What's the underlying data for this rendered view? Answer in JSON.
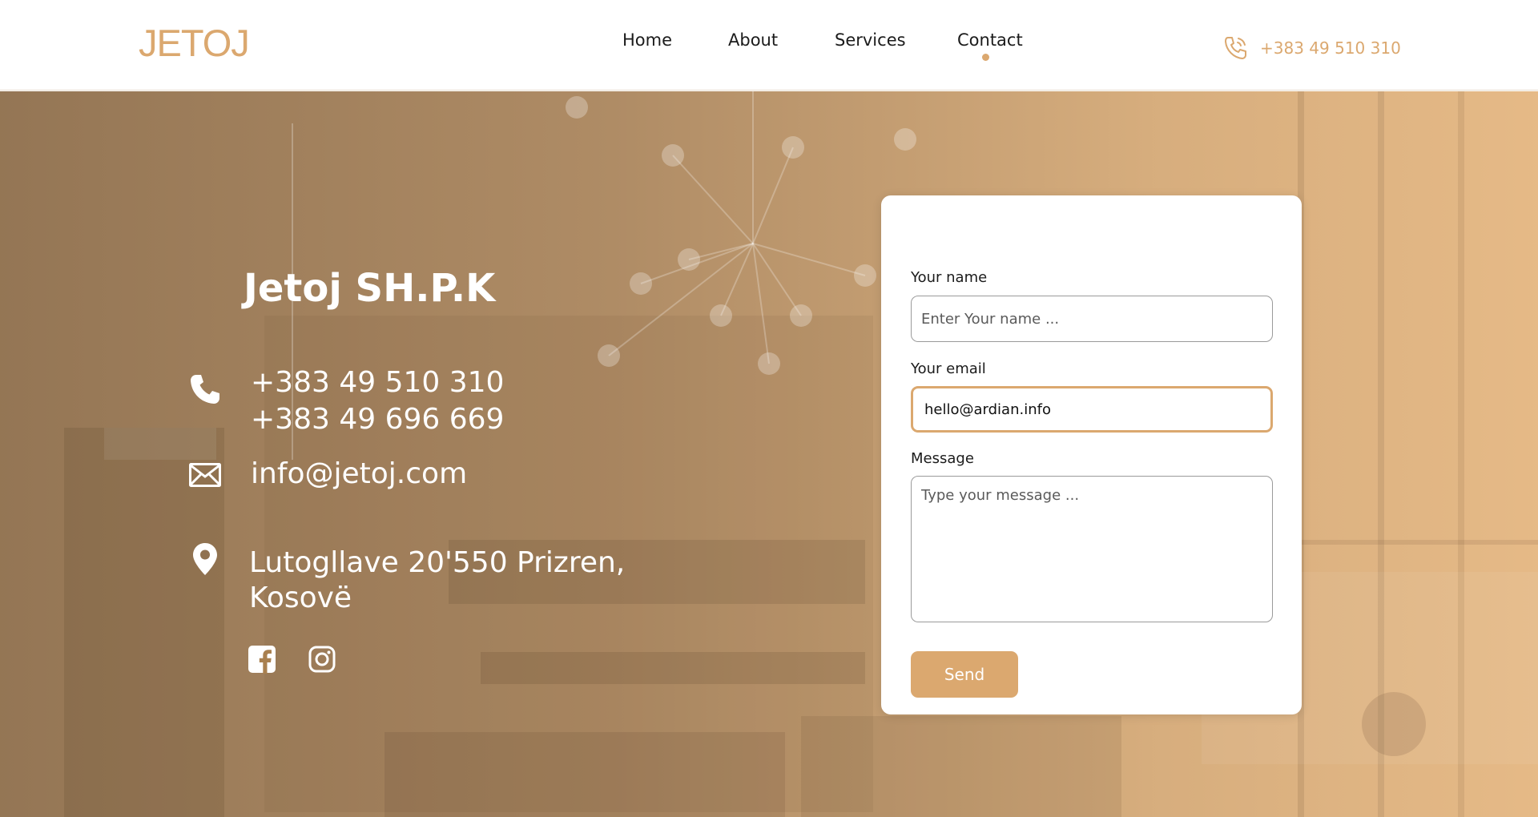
{
  "header": {
    "logo": "JETOJ",
    "nav": [
      {
        "label": "Home"
      },
      {
        "label": "About"
      },
      {
        "label": "Services"
      },
      {
        "label": "Contact"
      }
    ],
    "active_nav": "Contact",
    "phone": "+383 49 510 310",
    "phone_icon": "phone-ringing-icon"
  },
  "contact": {
    "company": "Jetoj SH.P.K",
    "phones": [
      "+383 49 510 310",
      "+383 49 696 669"
    ],
    "email": "info@jetoj.com",
    "address_line1": "Lutogllave 20'550 Prizren,",
    "address_line2": "Kosovë",
    "social": [
      "facebook-icon",
      "instagram-icon"
    ]
  },
  "form": {
    "name_label": "Your name",
    "name_placeholder": "Enter Your name ...",
    "email_label": "Your email",
    "email_value": "hello@ardian.info",
    "message_label": "Message",
    "message_placeholder": "Type your message ...",
    "send_label": "Send"
  },
  "colors": {
    "accent": "#dba86f",
    "text_dark": "#1b1b1b",
    "overlay_left": "#8b6a46",
    "overlay_right": "#e2b076"
  }
}
